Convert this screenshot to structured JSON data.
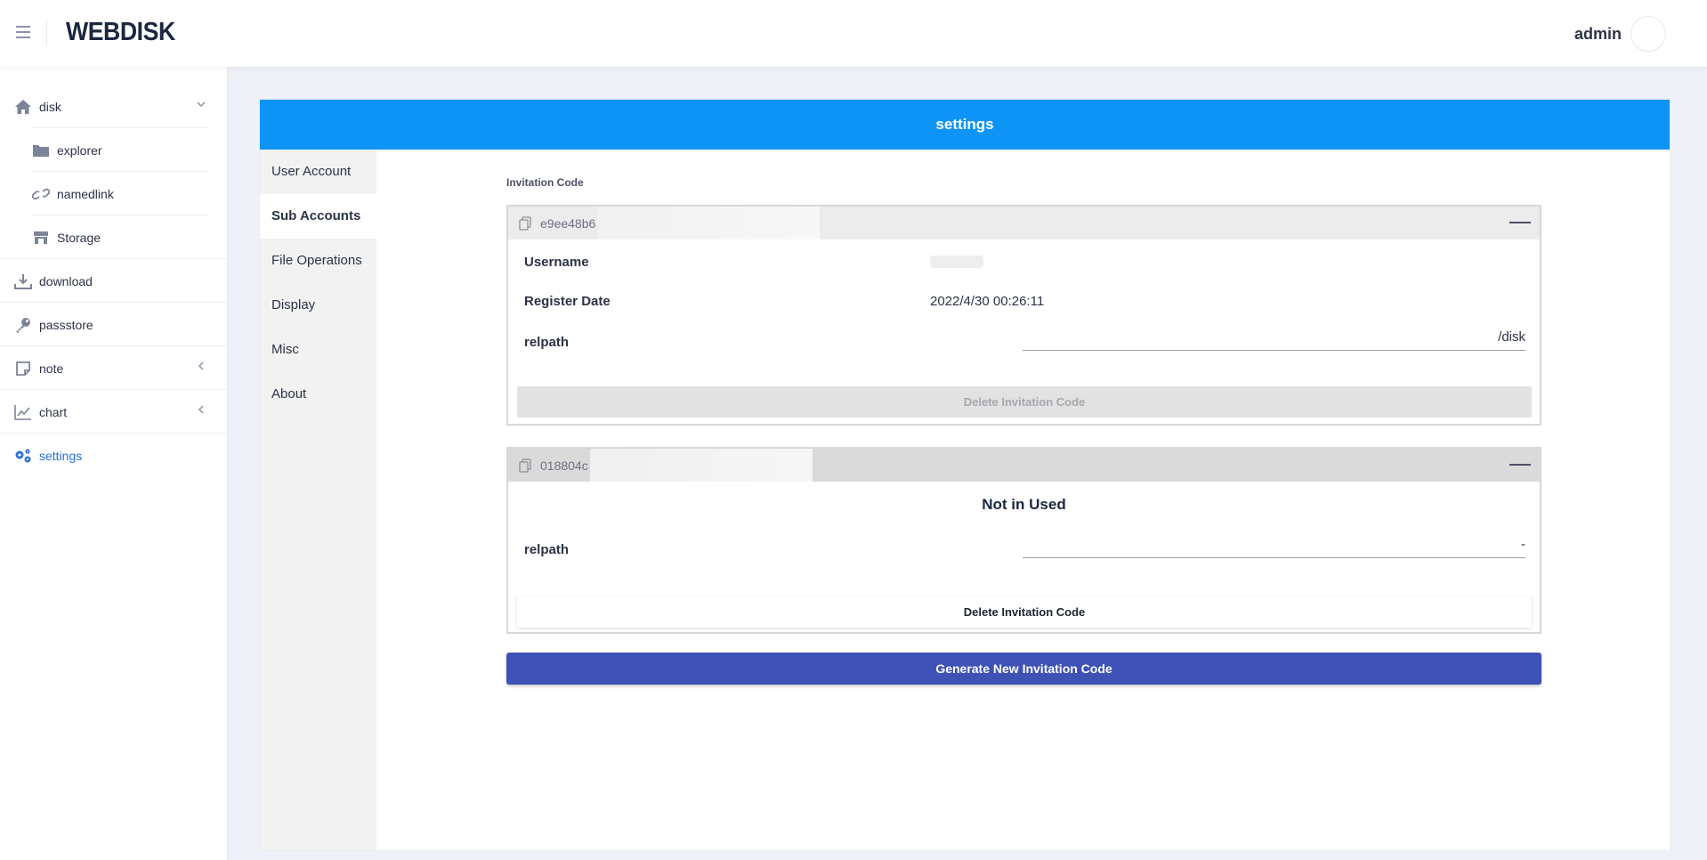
{
  "app": {
    "brand": "WEBDISK",
    "user": "admin"
  },
  "sidebar": {
    "items": [
      {
        "label": "disk",
        "icon": "home-icon"
      },
      {
        "label": "explorer",
        "icon": "folder-icon"
      },
      {
        "label": "namedlink",
        "icon": "link-icon"
      },
      {
        "label": "Storage",
        "icon": "store-icon"
      },
      {
        "label": "download",
        "icon": "download-icon"
      },
      {
        "label": "passstore",
        "icon": "key-icon"
      },
      {
        "label": "note",
        "icon": "note-icon"
      },
      {
        "label": "chart",
        "icon": "chart-line-icon"
      },
      {
        "label": "settings",
        "icon": "gears-icon"
      }
    ]
  },
  "card": {
    "title": "settings"
  },
  "tabs": [
    "User Account",
    "Sub Accounts",
    "File Operations",
    "Display",
    "Misc",
    "About"
  ],
  "section": {
    "title": "Invitation Code"
  },
  "codes": [
    {
      "code_prefix": "e9ee48b6",
      "username_label": "Username",
      "register_date_label": "Register Date",
      "register_date": "2022/4/30 00:26:11",
      "relpath_label": "relpath",
      "relpath": "/disk",
      "delete_label": "Delete Invitation Code"
    },
    {
      "code_prefix": "018804c",
      "status": "Not in Used",
      "relpath_label": "relpath",
      "relpath": "-",
      "delete_label": "Delete Invitation Code"
    }
  ],
  "generate_label": "Generate New Invitation Code",
  "colors": {
    "header_blue": "#0e94f7",
    "accent_indigo": "#3e51b5",
    "active_link": "#2b6fd8"
  }
}
